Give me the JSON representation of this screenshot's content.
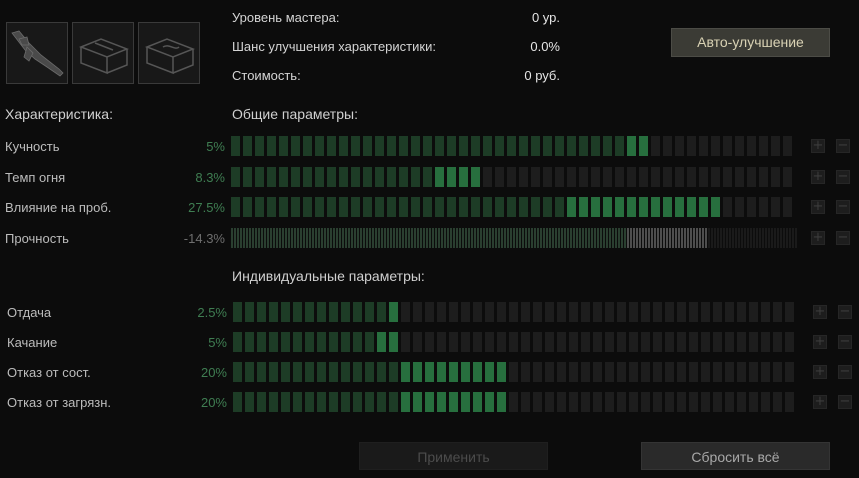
{
  "info": {
    "master_level_label": "Уровень мастера:",
    "master_level_value": "0 ур.",
    "upgrade_chance_label": "Шанс улучшения характеристики:",
    "upgrade_chance_value": "0.0%",
    "cost_label": "Стоимость:",
    "cost_value": "0 руб."
  },
  "auto_upgrade_label": "Авто-улучшение",
  "characteristics_heading": "Характеристика:",
  "general_heading": "Общие параметры:",
  "individual_heading": "Индивидуальные параметры:",
  "general_stats": [
    {
      "name": "Кучность",
      "percent": "5%",
      "base_fraction": 0.7,
      "bonus_fraction": 0.05
    },
    {
      "name": "Темп огня",
      "percent": "8.3%",
      "base_fraction": 0.37,
      "bonus_fraction": 0.08
    },
    {
      "name": "Влияние на проб.",
      "percent": "27.5%",
      "base_fraction": 0.59,
      "bonus_fraction": 0.27
    },
    {
      "name": "Прочность",
      "percent": "-14.3%",
      "base_fraction": 0.84,
      "bonus_fraction": 0.14,
      "negative": true
    }
  ],
  "individual_stats": [
    {
      "name": "Отдача",
      "percent": "2.5%",
      "base_fraction": 0.28,
      "bonus_fraction": 0.025
    },
    {
      "name": "Качание",
      "percent": "5%",
      "base_fraction": 0.26,
      "bonus_fraction": 0.05
    },
    {
      "name": "Отказ от сост.",
      "percent": "20%",
      "base_fraction": 0.3,
      "bonus_fraction": 0.2
    },
    {
      "name": "Отказ от загрязн.",
      "percent": "20%",
      "base_fraction": 0.3,
      "bonus_fraction": 0.2
    }
  ],
  "icons": {
    "slot1": "rifle-icon",
    "slot2": "toolbox-icon",
    "slot3": "toolbox-icon",
    "plus": "plus-icon",
    "minus": "minus-icon"
  },
  "plus_glyph": "+",
  "minus_glyph": "−",
  "apply_label": "Применить",
  "reset_label": "Сбросить всё",
  "colors": {
    "base_segment": "#1d3c26",
    "bonus_segment": "#276f3e",
    "empty_segment": "#1d1d1d",
    "accent_button": "#3b3b35"
  }
}
